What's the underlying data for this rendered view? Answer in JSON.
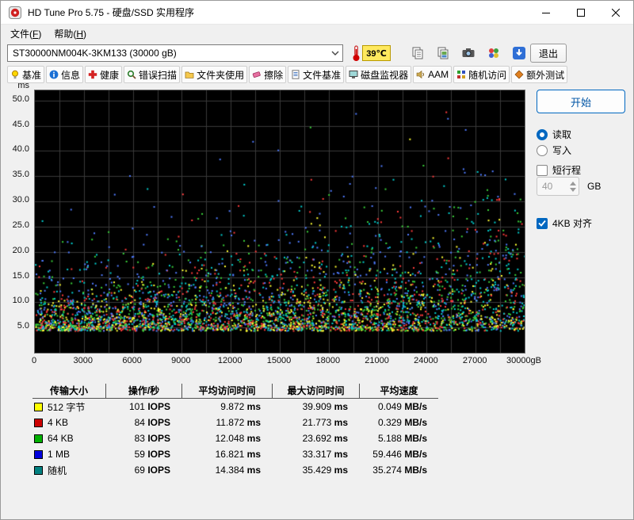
{
  "window": {
    "title": "HD Tune Pro 5.75 - 硬盘/SSD 实用程序"
  },
  "menu": {
    "items": [
      {
        "pre": "文件(",
        "key": "F",
        "post": ")"
      },
      {
        "pre": "帮助(",
        "key": "H",
        "post": ")"
      }
    ]
  },
  "toolbar": {
    "drive_value": "ST30000NM004K-3KM133 (30000 gB)",
    "temperature": "39℃",
    "icons": [
      "copy-text-icon",
      "copy-image-icon",
      "camera-icon",
      "palette-icon",
      "save-icon"
    ],
    "exit_label": "退出"
  },
  "tabs": [
    {
      "id": "benchmark",
      "label": "基准",
      "icon": "benchmark-icon"
    },
    {
      "id": "info",
      "label": "信息",
      "icon": "info-icon"
    },
    {
      "id": "health",
      "label": "健康",
      "icon": "health-icon"
    },
    {
      "id": "error-scan",
      "label": "错误扫描",
      "icon": "error-scan-icon"
    },
    {
      "id": "folder-usage",
      "label": "文件夹使用",
      "icon": "folder-usage-icon"
    },
    {
      "id": "erase",
      "label": "擦除",
      "icon": "erase-icon"
    },
    {
      "id": "file-benchmark",
      "label": "文件基准",
      "icon": "file-benchmark-icon"
    },
    {
      "id": "disk-monitor",
      "label": "磁盘监视器",
      "icon": "disk-monitor-icon"
    },
    {
      "id": "aam",
      "label": "AAM",
      "icon": "aam-icon"
    },
    {
      "id": "random-access",
      "label": "随机访问",
      "icon": "random-access-icon"
    },
    {
      "id": "extra-tests",
      "label": "额外测试",
      "icon": "extra-tests-icon"
    }
  ],
  "side_panel": {
    "start_label": "开始",
    "read_label": "读取",
    "read_selected": true,
    "write_label": "写入",
    "write_selected": false,
    "short_stroke_label": "短行程",
    "short_stroke_checked": false,
    "short_stroke_value": "40",
    "short_stroke_unit": "GB",
    "align_label": "4KB 对齐",
    "align_checked": true
  },
  "table": {
    "headers": [
      "传输大小",
      "操作/秒",
      "平均访问时间",
      "最大访问时间",
      "平均速度"
    ],
    "units": {
      "iops": "IOPS",
      "time": "ms",
      "speed": "MB/s"
    },
    "rows": [
      {
        "color": "#ffff00",
        "label": "512 字节",
        "iops": "101",
        "avg": "9.872",
        "max": "39.909",
        "speed": "0.049"
      },
      {
        "color": "#cc0000",
        "label": "4 KB",
        "iops": "84",
        "avg": "11.872",
        "max": "21.773",
        "speed": "0.329"
      },
      {
        "color": "#00b000",
        "label": "64 KB",
        "iops": "83",
        "avg": "12.048",
        "max": "23.692",
        "speed": "5.188"
      },
      {
        "color": "#0000dd",
        "label": "1 MB",
        "iops": "59",
        "avg": "16.821",
        "max": "33.317",
        "speed": "59.446"
      },
      {
        "color": "#008080",
        "label": "随机",
        "iops": "69",
        "avg": "14.384",
        "max": "35.429",
        "speed": "35.274"
      }
    ]
  },
  "chart_data": {
    "type": "scatter",
    "title": "",
    "y_unit": "ms",
    "x_unit": "gB",
    "x_range": [
      0,
      30000
    ],
    "y_range": [
      0,
      52
    ],
    "x_ticks": [
      "0",
      "3000",
      "6000",
      "9000",
      "12000",
      "15000",
      "18000",
      "21000",
      "24000",
      "27000",
      "30000gB"
    ],
    "y_ticks": [
      "50.0",
      "45.0",
      "40.0",
      "35.0",
      "30.0",
      "25.0",
      "20.0",
      "15.0",
      "10.0",
      "5.0"
    ],
    "grid": {
      "x_step": 1500,
      "y_step": 5,
      "color": "#3a3a3a"
    },
    "background": "#000000",
    "base_ms": 4.3,
    "seed": 987654321,
    "point_series": [
      {
        "name": "512 字节",
        "color": "#ffff33",
        "points": 760,
        "scale": 0.75
      },
      {
        "name": "4 KB",
        "color": "#ff3b3b",
        "points": 760,
        "scale": 0.95
      },
      {
        "name": "64 KB",
        "color": "#39d039",
        "points": 760,
        "scale": 1.0
      },
      {
        "name": "1 MB",
        "color": "#4f7bff",
        "points": 760,
        "scale": 1.45
      },
      {
        "name": "随机",
        "color": "#00cfcf",
        "points": 760,
        "scale": 1.15
      }
    ]
  }
}
